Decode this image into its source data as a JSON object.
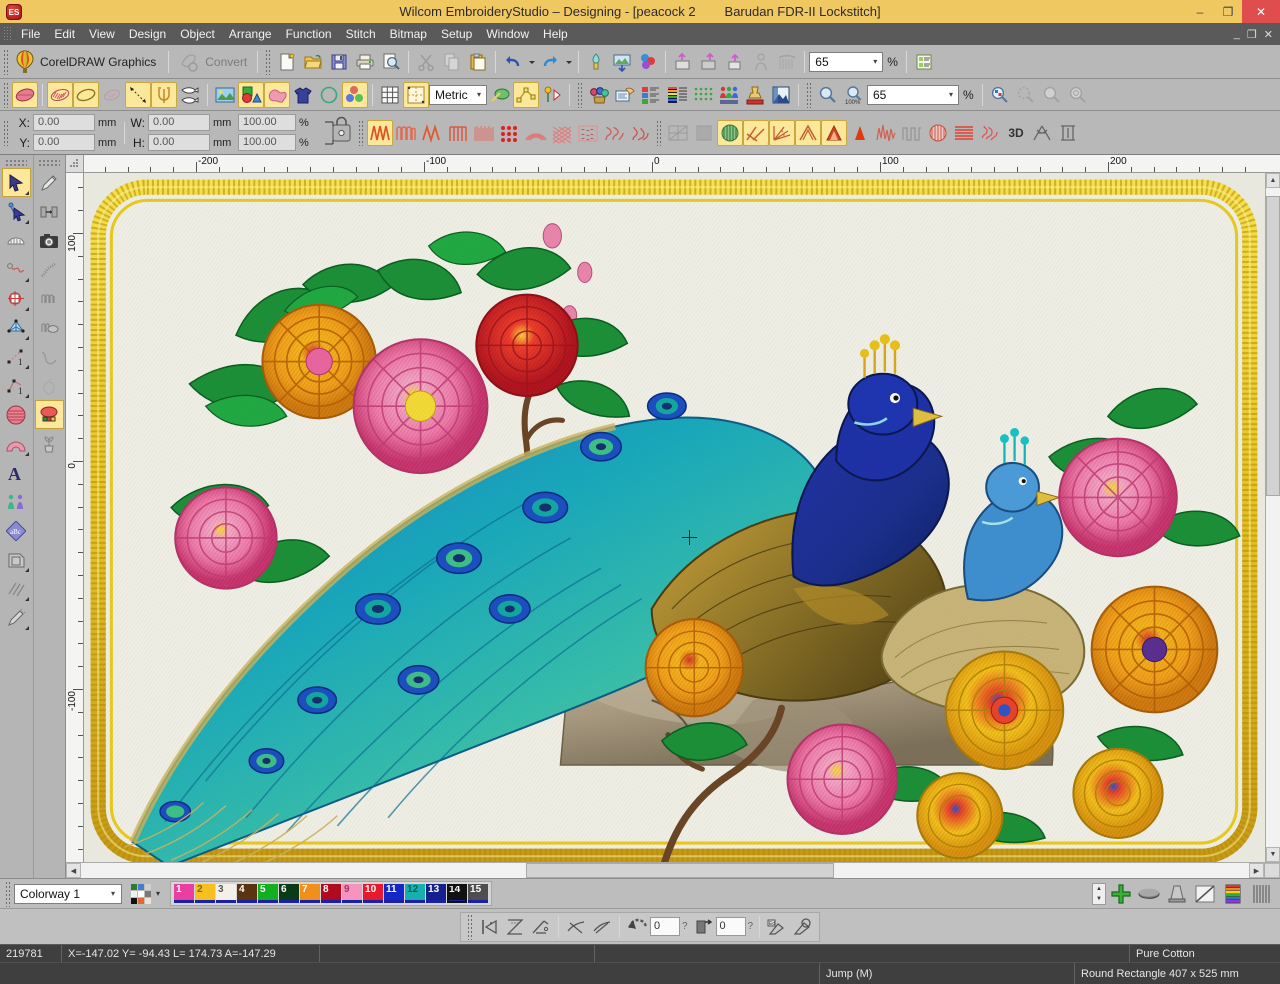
{
  "window": {
    "app_logo": "ES",
    "title": "Wilcom EmbroideryStudio – Designing - [peacock 2        Barudan FDR-II Lockstitch]",
    "minimize": "–",
    "maximize": "❐",
    "close": "✕",
    "mdi_minimize": "_",
    "mdi_restore": "❐",
    "mdi_close": "✕"
  },
  "menu": {
    "items": [
      "File",
      "Edit",
      "View",
      "Design",
      "Object",
      "Arrange",
      "Function",
      "Stitch",
      "Bitmap",
      "Setup",
      "Window",
      "Help"
    ]
  },
  "toolbar_standard": {
    "corel_label": "CorelDRAW Graphics",
    "corel_icon": "corel-balloon-icon",
    "convert_label": "Convert",
    "convert_icon": "convert-hand-icon",
    "buttons": [
      {
        "name": "new-icon",
        "title": "New"
      },
      {
        "name": "open-icon",
        "title": "Open"
      },
      {
        "name": "save-icon",
        "title": "Save"
      },
      {
        "name": "print-icon",
        "title": "Print"
      },
      {
        "name": "print-preview-icon",
        "title": "Print Preview"
      },
      {
        "name": "cut-icon",
        "title": "Cut"
      },
      {
        "name": "copy-icon",
        "title": "Copy"
      },
      {
        "name": "paste-icon",
        "title": "Paste"
      },
      {
        "name": "undo-icon",
        "title": "Undo"
      },
      {
        "name": "undo-dropdown-icon",
        "title": "Undo list"
      },
      {
        "name": "redo-icon",
        "title": "Redo"
      },
      {
        "name": "redo-dropdown-icon",
        "title": "Redo list"
      },
      {
        "name": "insert-artwork-icon",
        "title": "Insert Artwork"
      },
      {
        "name": "insert-picture-icon",
        "title": "Insert Picture"
      },
      {
        "name": "color-wheel-icon",
        "title": "Color Wheel"
      },
      {
        "name": "machine-read-icon",
        "title": "Read From Machine"
      },
      {
        "name": "machine-write-icon",
        "title": "Write To Machine"
      },
      {
        "name": "machine-export-icon",
        "title": "Export Machine File"
      },
      {
        "name": "person-icon",
        "title": "Person"
      },
      {
        "name": "hoop-icon",
        "title": "Hoop"
      }
    ],
    "zoom_value": "65",
    "zoom_unit": "%",
    "properties_icon": "object-properties-icon"
  },
  "toolbar_objects": {
    "units_value": "Metric",
    "zoom_value": "65",
    "zoom_unit": "%",
    "buttons": [
      {
        "name": "satin-fill-icon"
      },
      {
        "name": "tatami-fill-icon"
      },
      {
        "name": "outline-shape-icon"
      },
      {
        "name": "motif-fill-icon"
      },
      {
        "name": "travel-run-icon"
      },
      {
        "name": "trident-icon"
      },
      {
        "name": "fish-stitch-icon"
      },
      {
        "name": "backdrop-icon"
      },
      {
        "name": "shapes-icon"
      },
      {
        "name": "cloud-shape-icon"
      },
      {
        "name": "garment-icon"
      },
      {
        "name": "ring-shape-icon"
      },
      {
        "name": "color-blend-icon"
      },
      {
        "name": "grid-icon"
      },
      {
        "name": "hoop-grid-icon"
      },
      {
        "name": "magic-wand-icon"
      },
      {
        "name": "node-edit-icon"
      },
      {
        "name": "flower-play-icon"
      },
      {
        "name": "colorway-editor-icon"
      },
      {
        "name": "design-properties-icon"
      },
      {
        "name": "color-film-icon"
      },
      {
        "name": "stitch-list-icon"
      },
      {
        "name": "thread-chart-icon"
      },
      {
        "name": "dot-matrix-icon"
      },
      {
        "name": "team-names-icon"
      },
      {
        "name": "stamp-icon"
      },
      {
        "name": "bitmap-view-icon"
      },
      {
        "name": "zoom-in-icon"
      },
      {
        "name": "zoom-100-icon"
      },
      {
        "name": "zoom-selection-icon"
      },
      {
        "name": "zoom-stitch-icon"
      },
      {
        "name": "zoom-bitmap-icon"
      },
      {
        "name": "zoom-all-icon"
      }
    ]
  },
  "property_bar": {
    "x_label": "X:",
    "x_value": "0.00",
    "x_unit": "mm",
    "y_label": "Y:",
    "y_value": "0.00",
    "y_unit": "mm",
    "w_label": "W:",
    "w_value": "0.00",
    "w_unit": "mm",
    "w_percent": "100.00",
    "h_label": "H:",
    "h_value": "0.00",
    "h_unit": "mm",
    "h_percent": "100.00",
    "percent_symbol": "%",
    "lock_icon": "aspect-ratio-lock-icon"
  },
  "stitch_types": {
    "buttons": [
      {
        "name": "zigzag-stitch-icon",
        "active": true
      },
      {
        "name": "e-stitch-icon",
        "active": false
      },
      {
        "name": "satin-stitch-icon",
        "active": false
      },
      {
        "name": "blanket-stitch-icon",
        "active": false
      },
      {
        "name": "tatami-stitch-icon",
        "active": false
      },
      {
        "name": "stipple-dots-icon",
        "active": false
      },
      {
        "name": "contour-stitch-icon",
        "active": false
      },
      {
        "name": "cross-stitch-icon",
        "active": false
      },
      {
        "name": "lacework-icon",
        "active": false
      },
      {
        "name": "motif-run-icon",
        "active": false
      },
      {
        "name": "curly-fill-icon",
        "active": false
      }
    ]
  },
  "effects": {
    "buttons": [
      {
        "name": "auto-spacing-icon",
        "active": false
      },
      {
        "name": "pattern-stamp-icon",
        "active": false
      },
      {
        "name": "fill-density-icon",
        "active": true
      },
      {
        "name": "stitch-angle-icon",
        "active": true
      },
      {
        "name": "stitch-direction-icon",
        "active": true
      },
      {
        "name": "auto-split-icon",
        "active": true
      },
      {
        "name": "peak-stitch-icon",
        "active": true
      },
      {
        "name": "sharp-peak-icon",
        "active": false
      },
      {
        "name": "random-zigzag-icon",
        "active": false
      },
      {
        "name": "square-wave-icon",
        "active": false
      },
      {
        "name": "textured-edge-icon",
        "active": false
      },
      {
        "name": "line-fill-icon",
        "active": false
      },
      {
        "name": "scribble-icon",
        "active": false
      },
      {
        "name": "3d-effect-icon",
        "label": "3D",
        "active": false
      },
      {
        "name": "knot-stitch-icon",
        "active": false
      },
      {
        "name": "column-stitch-icon",
        "active": false
      }
    ]
  },
  "left_toolbox": {
    "column_a": [
      {
        "name": "select-tool-icon",
        "selected": true,
        "flyout": true
      },
      {
        "name": "reshape-node-tool-icon",
        "selected": false,
        "flyout": true
      },
      {
        "name": "hoop-arc-tool-icon",
        "selected": false,
        "flyout": false
      },
      {
        "name": "curve-stitch-tool-icon",
        "selected": false,
        "flyout": true
      },
      {
        "name": "mirror-merge-tool-icon",
        "selected": false,
        "flyout": true
      },
      {
        "name": "magic-wand-tool-icon",
        "selected": false,
        "flyout": true
      },
      {
        "name": "open-object-tool-icon",
        "selected": false,
        "flyout": true
      },
      {
        "name": "closed-object-tool-icon",
        "selected": false,
        "flyout": true
      },
      {
        "name": "circle-fill-tool-icon",
        "selected": false,
        "flyout": false
      },
      {
        "name": "ring-fill-tool-icon",
        "selected": false,
        "flyout": true
      },
      {
        "name": "lettering-tool-icon",
        "selected": false,
        "flyout": false
      },
      {
        "name": "monogram-tool-icon",
        "selected": false,
        "flyout": false
      },
      {
        "name": "abc-motif-tool-icon",
        "selected": false,
        "flyout": false
      },
      {
        "name": "appliqué-tool-icon",
        "selected": false,
        "flyout": true
      },
      {
        "name": "hatch-fill-tool-icon",
        "selected": false,
        "flyout": true
      },
      {
        "name": "freehand-pen-tool-icon",
        "selected": false,
        "flyout": true
      }
    ],
    "column_b": [
      {
        "name": "pencil-tool-icon",
        "selected": false
      },
      {
        "name": "align-objects-icon",
        "selected": false
      },
      {
        "name": "camera-capture-icon",
        "selected": false
      },
      {
        "name": "caterpillar-stitch-icon",
        "selected": false
      },
      {
        "name": "coil-stitch-icon",
        "selected": false
      },
      {
        "name": "coil-fill-icon",
        "selected": false
      },
      {
        "name": "wave-line-icon",
        "selected": false
      },
      {
        "name": "apple-outline-icon",
        "selected": false
      },
      {
        "name": "color-picker-icon",
        "selected": true
      },
      {
        "name": "plant-tool-icon",
        "selected": false
      }
    ]
  },
  "ruler": {
    "horizontal_labels": [
      "-200",
      "-100",
      "0",
      "100",
      "200"
    ],
    "vertical_labels": [
      "100",
      "0",
      "-100"
    ],
    "units": "mm"
  },
  "canvas": {
    "design_name": "peacock 2",
    "background_color": "#e9e8df",
    "fabric_color": "#efeee4"
  },
  "colorway_bar": {
    "colorway_label": "Colorway 1",
    "palette_icon": "color-palette-icon",
    "dropdown_arrow": "▾",
    "swatches": [
      {
        "number": "1",
        "color": "#ea3ea0",
        "text_color": "#ffffff"
      },
      {
        "number": "2",
        "color": "#f5c020",
        "text_color": "#8a6a00"
      },
      {
        "number": "3",
        "color": "#f2f0e8",
        "text_color": "#555555"
      },
      {
        "number": "4",
        "color": "#5a3311",
        "text_color": "#ffffff"
      },
      {
        "number": "5",
        "color": "#12b021",
        "text_color": "#ffffff"
      },
      {
        "number": "6",
        "color": "#0a3b18",
        "text_color": "#ffffff"
      },
      {
        "number": "7",
        "color": "#f08f1b",
        "text_color": "#ffffff"
      },
      {
        "number": "8",
        "color": "#b00a1e",
        "text_color": "#ffffff"
      },
      {
        "number": "9",
        "color": "#f794bd",
        "text_color": "#a13764"
      },
      {
        "number": "10",
        "color": "#e8192c",
        "text_color": "#ffffff"
      },
      {
        "number": "11",
        "color": "#1428c8",
        "text_color": "#ffffff"
      },
      {
        "number": "12",
        "color": "#17b0ae",
        "text_color": "#0a5e5d"
      },
      {
        "number": "13",
        "color": "#14218c",
        "text_color": "#ffffff"
      },
      {
        "number": "14",
        "color": "#111111",
        "text_color": "#ffffff",
        "selected": true
      },
      {
        "number": "15",
        "color": "#4e4e4e",
        "text_color": "#ffffff"
      }
    ],
    "right_buttons": [
      {
        "name": "spinner-updown-icon"
      },
      {
        "name": "add-color-icon"
      },
      {
        "name": "thread-spool-icon"
      },
      {
        "name": "thread-cone-icon"
      },
      {
        "name": "no-color-icon"
      },
      {
        "name": "color-chart-icon"
      },
      {
        "name": "thread-range-icon"
      }
    ]
  },
  "stitch_toolbar": {
    "buttons": [
      {
        "name": "stitch-first-icon"
      },
      {
        "name": "stitch-previous-icon"
      },
      {
        "name": "stitch-next-icon"
      },
      {
        "name": "stitch-back-icon"
      },
      {
        "name": "stitch-forward-icon"
      },
      {
        "name": "stitch-reverse-icon"
      }
    ],
    "field1_value": "0",
    "field2_value": "0",
    "help1": "?",
    "help2": "?",
    "extra_buttons": [
      {
        "name": "travel-by-color-icon"
      },
      {
        "name": "travel-by-object-icon"
      },
      {
        "name": "edit-stitch-icon"
      },
      {
        "name": "stitch-player-icon"
      }
    ]
  },
  "status_bar": {
    "stitch_count": "219781",
    "coordinates": "X=-147.02 Y= -94.43 L= 174.73 A=-147.29",
    "fabric": "Pure Cotton",
    "function": "Jump (M)",
    "hoop": "Round Rectangle 407 x 525 mm"
  }
}
